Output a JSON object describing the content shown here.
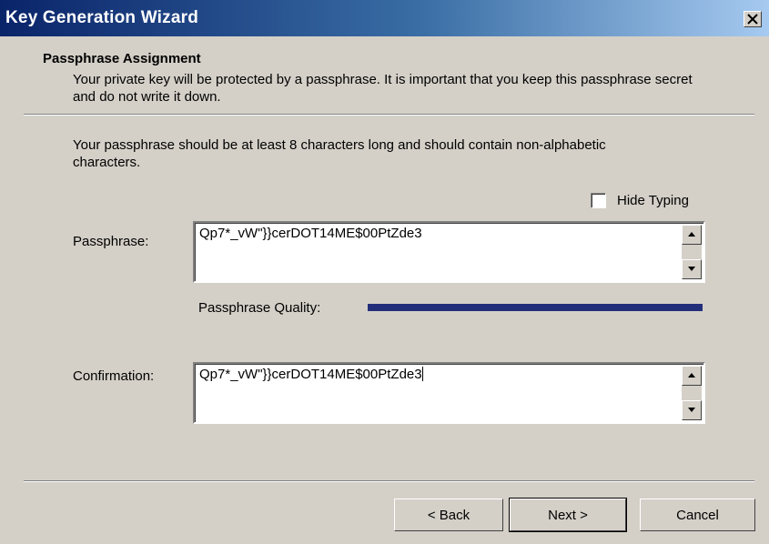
{
  "window": {
    "title": "Key Generation Wizard",
    "close_label": "×"
  },
  "header": {
    "title": "Passphrase Assignment",
    "description": "Your private key will be protected by a passphrase.  It is important that you keep this passphrase secret and do not write it down."
  },
  "instructions": "Your passphrase should be at least 8 characters long and should contain non-alphabetic characters.",
  "hide_typing": {
    "label": "Hide Typing",
    "checked": false
  },
  "passphrase": {
    "label": "Passphrase:",
    "value": "Qp7*_vW\"}}cerDOT14ME$00PtZde3"
  },
  "quality": {
    "label": "Passphrase Quality:",
    "level": 1.0,
    "color": "#232e7a"
  },
  "confirmation": {
    "label": "Confirmation:",
    "value": "Qp7*_vW\"}}cerDOT14ME$00PtZde3"
  },
  "buttons": {
    "back": "< Back",
    "next": "Next >",
    "cancel": "Cancel"
  },
  "icons": {
    "close": "close-icon",
    "scroll_up": "arrow-up-icon",
    "scroll_down": "arrow-down-icon"
  }
}
